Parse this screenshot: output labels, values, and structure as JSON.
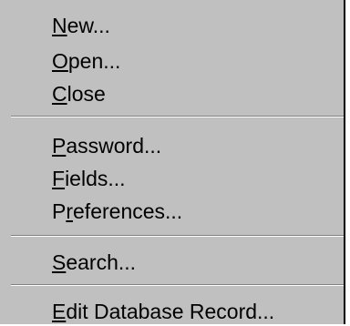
{
  "menu": {
    "items": [
      {
        "pre": "",
        "mnemonic": "N",
        "post": "ew..."
      },
      {
        "pre": "",
        "mnemonic": "O",
        "post": "pen..."
      },
      {
        "pre": "",
        "mnemonic": "C",
        "post": "lose"
      },
      {
        "pre": "",
        "mnemonic": "P",
        "post": "assword..."
      },
      {
        "pre": "",
        "mnemonic": "F",
        "post": "ields..."
      },
      {
        "pre": "P",
        "mnemonic": "r",
        "post": "eferences..."
      },
      {
        "pre": "",
        "mnemonic": "S",
        "post": "earch..."
      },
      {
        "pre": "",
        "mnemonic": "E",
        "post": "dit Database Record..."
      }
    ]
  },
  "colors": {
    "menu_background": "#c0c0c0",
    "separator_dark": "#808080",
    "separator_light": "#ffffff",
    "text": "#000000"
  }
}
